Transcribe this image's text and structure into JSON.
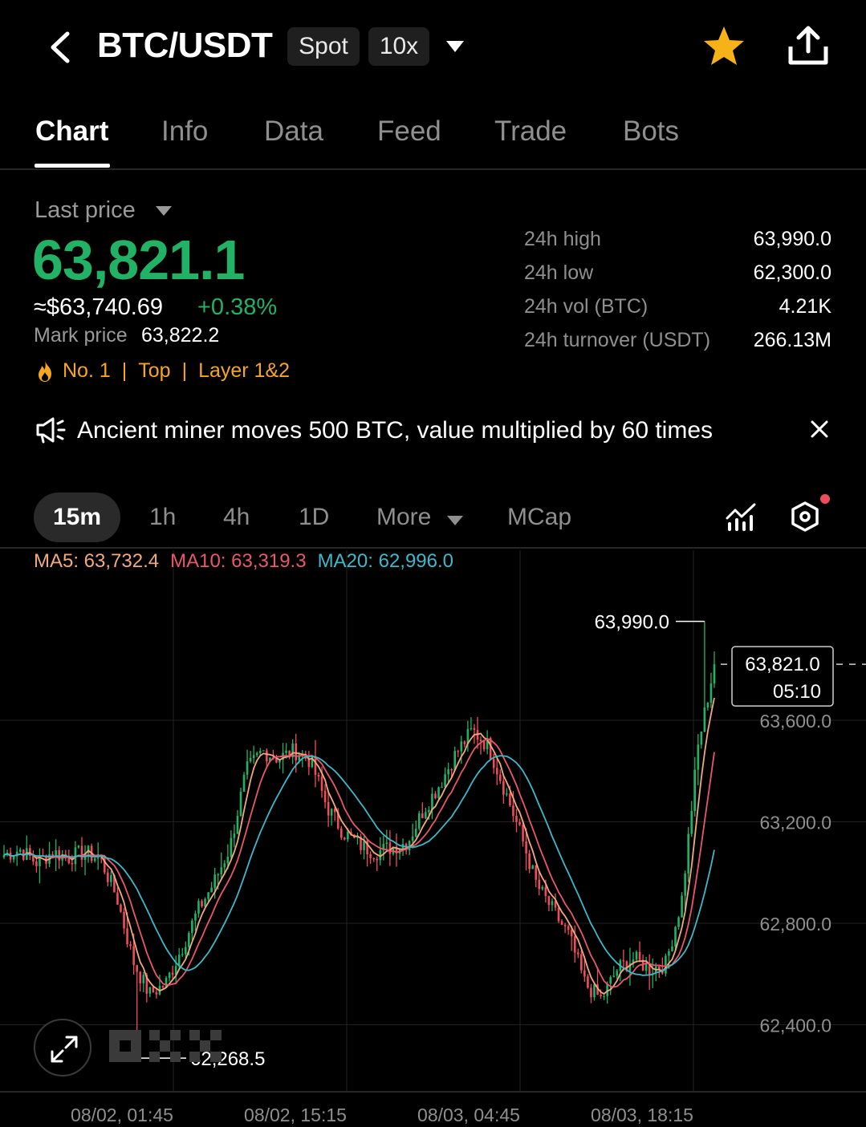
{
  "header": {
    "pair": "BTC/USDT",
    "market_type": "Spot",
    "leverage": "10x",
    "icons": {
      "back": "back-arrow-icon",
      "dropdown": "caret-down-icon",
      "favorite": "star-icon",
      "share": "share-icon"
    },
    "star_color": "#f7b218"
  },
  "tabs": [
    {
      "label": "Chart",
      "active": true
    },
    {
      "label": "Info"
    },
    {
      "label": "Data"
    },
    {
      "label": "Feed"
    },
    {
      "label": "Trade"
    },
    {
      "label": "Bots"
    }
  ],
  "price": {
    "label": "Last price",
    "last": "63,821.1",
    "approx_usd": "≈$63,740.69",
    "change": "+0.38%",
    "mark_label": "Mark price",
    "mark_value": "63,822.2",
    "tags": [
      "No. 1",
      "Top",
      "Layer 1&2"
    ],
    "up_color": "#22b266",
    "tag_color": "#f5a623"
  },
  "stats": [
    {
      "label": "24h high",
      "value": "63,990.0"
    },
    {
      "label": "24h low",
      "value": "62,300.0"
    },
    {
      "label": "24h vol (BTC)",
      "value": "4.21K"
    },
    {
      "label": "24h turnover (USDT)",
      "value": "266.13M"
    }
  ],
  "announcement": {
    "text": "Ancient miner moves 500 BTC, value multiplied by 60 times",
    "icon": "megaphone-icon"
  },
  "timeframes": {
    "items": [
      "15m",
      "1h",
      "4h",
      "1D"
    ],
    "active": "15m",
    "more": "More",
    "mcap": "MCap"
  },
  "chart_data": {
    "type": "candlestick",
    "interval": "15m",
    "moving_averages": [
      {
        "name": "MA5",
        "label": "MA5: 63,732.4",
        "color": "#f2a97d"
      },
      {
        "name": "MA10",
        "label": "MA10: 63,319.3",
        "color": "#e8586b"
      },
      {
        "name": "MA20",
        "label": "MA20: 62,996.0",
        "color": "#3fb8c8"
      }
    ],
    "y_ticks": [
      {
        "value": 63600,
        "label": "63,600.0"
      },
      {
        "value": 63200,
        "label": "63,200.0"
      },
      {
        "value": 62800,
        "label": "62,800.0"
      },
      {
        "value": 62400,
        "label": "62,400.0"
      }
    ],
    "x_ticks": [
      "08/02, 01:45",
      "08/02, 15:15",
      "08/03, 04:45",
      "08/03, 18:15"
    ],
    "high_marker": {
      "value": 63990.0,
      "label": "63,990.0"
    },
    "low_marker": {
      "value": 62268.5,
      "label": "62,268.5"
    },
    "current": {
      "price": "63,821.0",
      "countdown": "05:10",
      "value": 63821.0
    },
    "close_path": [
      63070,
      63090,
      63040,
      63080,
      63060,
      63080,
      63050,
      62900,
      62650,
      62520,
      62560,
      62700,
      62850,
      62960,
      63100,
      63400,
      63480,
      63450,
      63480,
      63440,
      63260,
      63160,
      63110,
      63080,
      63100,
      63120,
      63250,
      63350,
      63470,
      63560,
      63500,
      63330,
      63150,
      62950,
      62850,
      62750,
      62560,
      62500,
      62620,
      62660,
      62620,
      62640,
      62900,
      63500,
      63821
    ],
    "up_color": "#22b266",
    "down_color": "#ef4d5b"
  }
}
